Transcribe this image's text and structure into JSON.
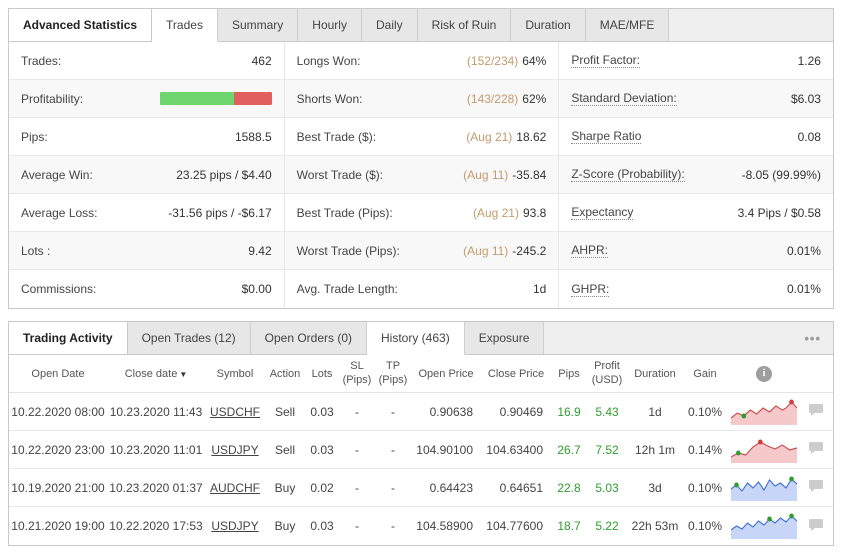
{
  "colors": {
    "positive": "#2d9e2d",
    "negative_bar": "#e06060",
    "positive_bar": "#6fd66f",
    "paren_text": "#c49a6c"
  },
  "icons": {
    "info": "i",
    "menu": "•••",
    "sort_desc": "▼"
  },
  "stats_panel": {
    "title": "Advanced Statistics",
    "tabs": [
      {
        "label": "Trades",
        "active": true
      },
      {
        "label": "Summary"
      },
      {
        "label": "Hourly"
      },
      {
        "label": "Daily"
      },
      {
        "label": "Risk of Ruin"
      },
      {
        "label": "Duration"
      },
      {
        "label": "MAE/MFE"
      }
    ],
    "profitability": {
      "green_pct": 66,
      "red_pct": 34
    },
    "col1": [
      {
        "label": "Trades:",
        "value": "462"
      },
      {
        "label": "Profitability:",
        "value": ""
      },
      {
        "label": "Pips:",
        "value": "1588.5"
      },
      {
        "label": "Average Win:",
        "value": "23.25 pips / $4.40"
      },
      {
        "label": "Average Loss:",
        "value": "-31.56 pips / -$6.17"
      },
      {
        "label": "Lots :",
        "value": "9.42"
      },
      {
        "label": "Commissions:",
        "value": "$0.00"
      }
    ],
    "col2": [
      {
        "label": "Longs Won:",
        "pre": "(152/234)",
        "value": "64%"
      },
      {
        "label": "Shorts Won:",
        "pre": "(143/228)",
        "value": "62%"
      },
      {
        "label": "Best Trade ($):",
        "pre": "(Aug 21)",
        "value": "18.62"
      },
      {
        "label": "Worst Trade ($):",
        "pre": "(Aug 11)",
        "value": "-35.84"
      },
      {
        "label": "Best Trade (Pips):",
        "pre": "(Aug 21)",
        "value": "93.8"
      },
      {
        "label": "Worst Trade (Pips):",
        "pre": "(Aug 11)",
        "value": "-245.2"
      },
      {
        "label": "Avg. Trade Length:",
        "pre": "",
        "value": "1d"
      }
    ],
    "col3": [
      {
        "label": "Profit Factor:",
        "value": "1.26"
      },
      {
        "label": "Standard Deviation:",
        "value": "$6.03"
      },
      {
        "label": "Sharpe Ratio",
        "value": "0.08"
      },
      {
        "label": "Z-Score (Probability):",
        "value": "-8.05 (99.99%)"
      },
      {
        "label": "Expectancy",
        "value": "3.4 Pips / $0.58"
      },
      {
        "label": "AHPR:",
        "value": "0.01%"
      },
      {
        "label": "GHPR:",
        "value": "0.01%"
      }
    ]
  },
  "activity_panel": {
    "title": "Trading Activity",
    "tabs": [
      {
        "label": "Open Trades (12)"
      },
      {
        "label": "Open Orders (0)"
      },
      {
        "label": "History (463)",
        "active": true
      },
      {
        "label": "Exposure"
      }
    ],
    "table": {
      "headers": {
        "open_date": "Open Date",
        "close_date": "Close date",
        "symbol": "Symbol",
        "action": "Action",
        "lots": "Lots",
        "sl1": "SL",
        "sl2": "(Pips)",
        "tp1": "TP",
        "tp2": "(Pips)",
        "open_price": "Open Price",
        "close_price": "Close Price",
        "pips": "Pips",
        "profit1": "Profit",
        "profit2": "(USD)",
        "duration": "Duration",
        "gain": "Gain"
      },
      "rows": [
        {
          "open_date": "10.22.2020 08:00",
          "close_date": "10.23.2020 11:43",
          "symbol": "USDCHF",
          "action": "Sell",
          "lots": "0.03",
          "sl": "-",
          "tp": "-",
          "open_price": "0.90638",
          "close_price": "0.90469",
          "pips": "16.9",
          "profit": "5.43",
          "duration": "1d",
          "gain": "0.10%",
          "spark_color": "red"
        },
        {
          "open_date": "10.22.2020 23:00",
          "close_date": "10.23.2020 11:01",
          "symbol": "USDJPY",
          "action": "Sell",
          "lots": "0.03",
          "sl": "-",
          "tp": "-",
          "open_price": "104.90100",
          "close_price": "104.63400",
          "pips": "26.7",
          "profit": "7.52",
          "duration": "12h 1m",
          "gain": "0.14%",
          "spark_color": "red"
        },
        {
          "open_date": "10.19.2020 21:00",
          "close_date": "10.23.2020 01:37",
          "symbol": "AUDCHF",
          "action": "Buy",
          "lots": "0.02",
          "sl": "-",
          "tp": "-",
          "open_price": "0.64423",
          "close_price": "0.64651",
          "pips": "22.8",
          "profit": "5.03",
          "duration": "3d",
          "gain": "0.10%",
          "spark_color": "blue"
        },
        {
          "open_date": "10.21.2020 19:00",
          "close_date": "10.22.2020 17:53",
          "symbol": "USDJPY",
          "action": "Buy",
          "lots": "0.03",
          "sl": "-",
          "tp": "-",
          "open_price": "104.58900",
          "close_price": "104.77600",
          "pips": "18.7",
          "profit": "5.22",
          "duration": "22h 53m",
          "gain": "0.10%",
          "spark_color": "blue"
        }
      ]
    }
  }
}
